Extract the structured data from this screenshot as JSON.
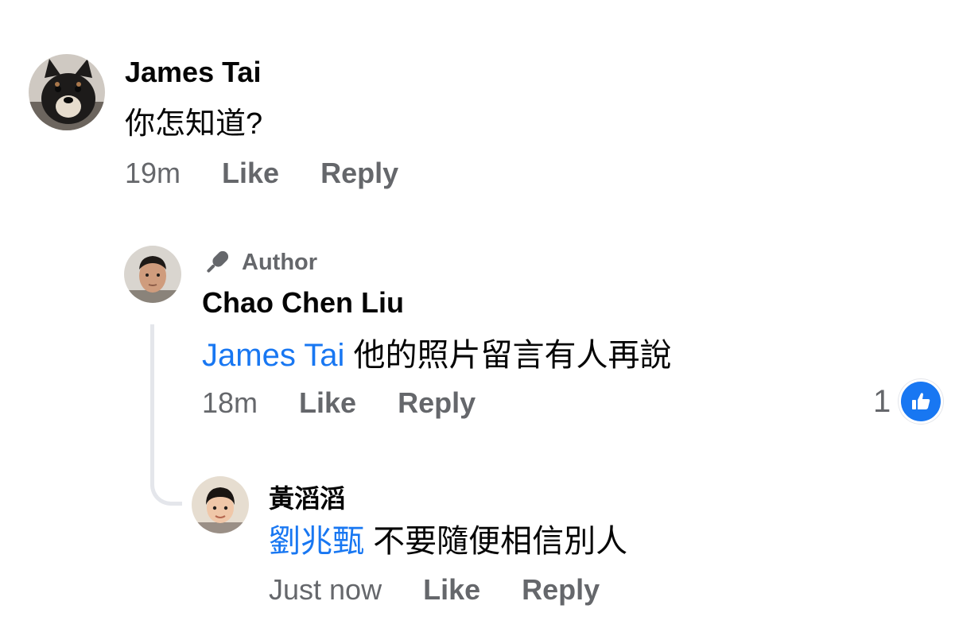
{
  "comments": [
    {
      "author": "James Tai",
      "text": "你怎知道?",
      "time": "19m",
      "like_label": "Like",
      "reply_label": "Reply",
      "avatar_icon": "dog-avatar"
    },
    {
      "author_badge": "Author",
      "badge_icon": "microphone-icon",
      "author": "Chao Chen Liu",
      "mention": "James Tai",
      "text": "他的照片留言有人再說",
      "time": "18m",
      "like_label": "Like",
      "reply_label": "Reply",
      "reaction_count": "1",
      "reaction_icon": "like-thumbs-up-icon",
      "avatar_icon": "man-avatar"
    },
    {
      "author": "黃滔滔",
      "mention": "劉兆甄",
      "text": "不要隨便相信別人",
      "time": "Just now",
      "like_label": "Like",
      "reply_label": "Reply",
      "avatar_icon": "boy-avatar"
    }
  ],
  "colors": {
    "mention": "#1877f2",
    "secondary_text": "#65676b",
    "reaction_blue": "#1877f2",
    "thread_line": "#e4e6eb"
  }
}
